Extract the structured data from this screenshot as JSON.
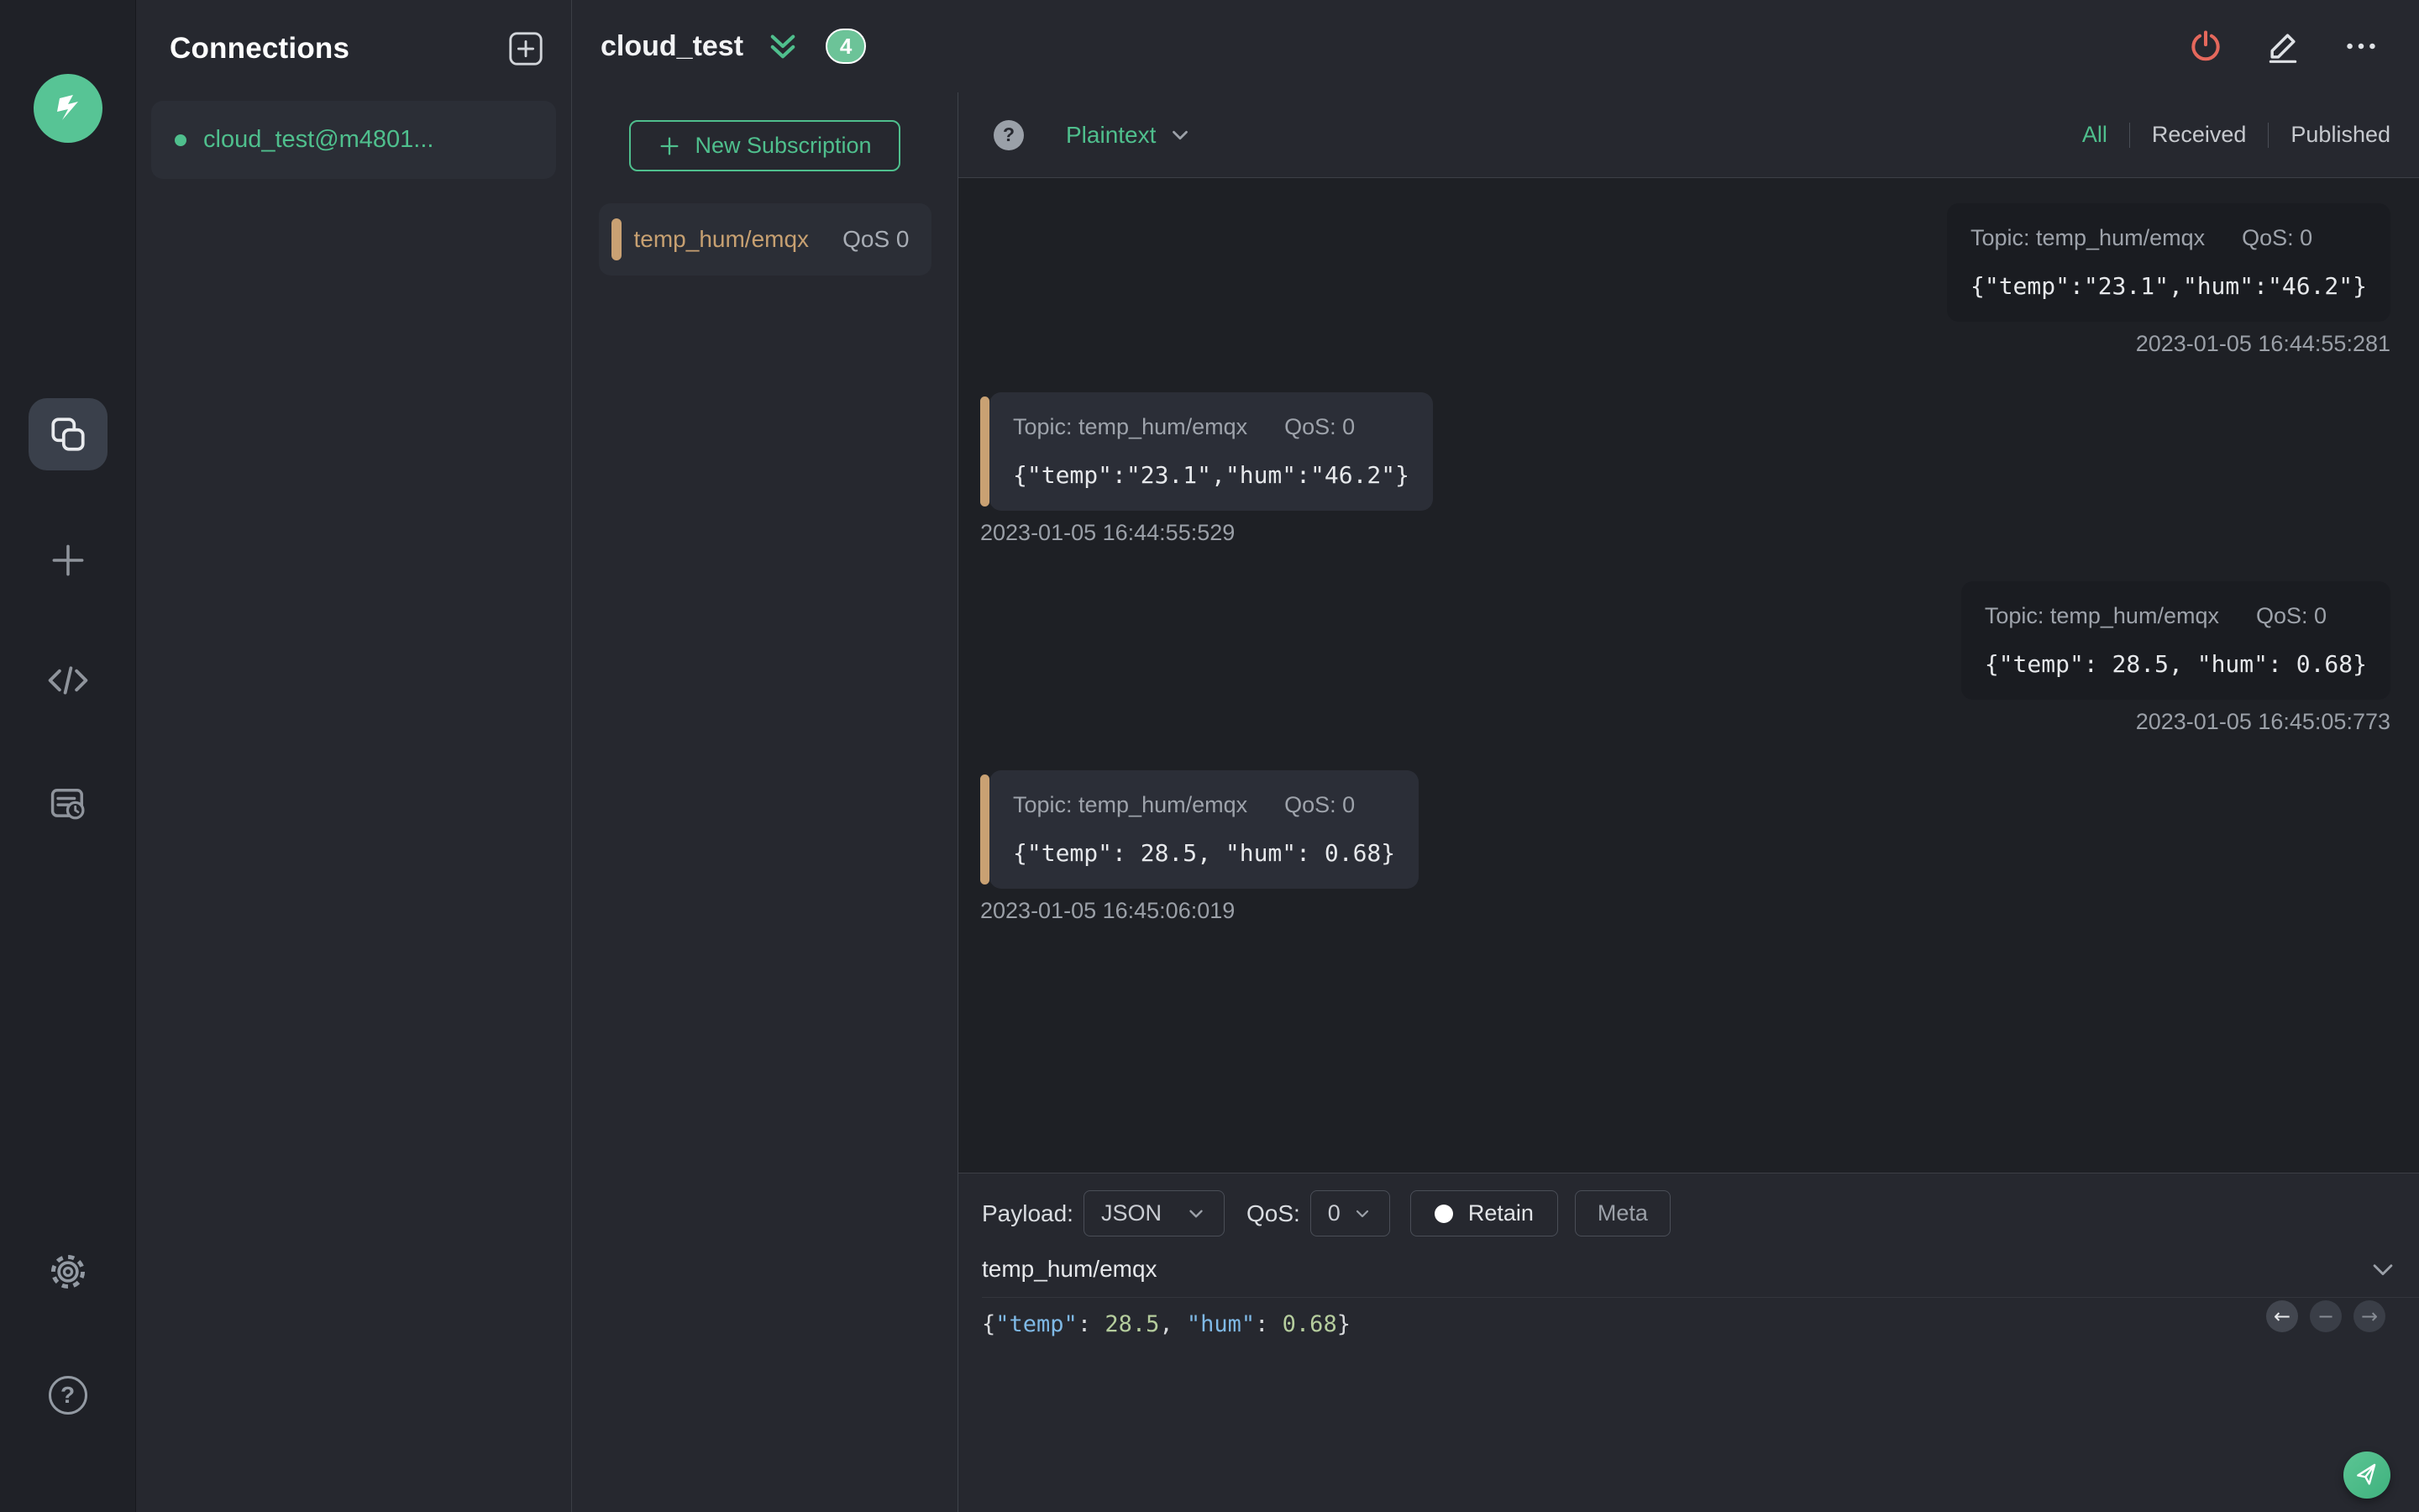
{
  "colors": {
    "accent_green": "#4fbf8d",
    "badge_green": "#6cc398",
    "subscription_accent": "#c9a173",
    "disconnect_red": "#e5685c",
    "editor_key_color": "#7fb9e6",
    "editor_number_color": "#b5cd9d"
  },
  "rail": {
    "icons": [
      "mqttx-logo",
      "connections",
      "new-connection",
      "script",
      "log",
      "settings",
      "help"
    ]
  },
  "connections_panel": {
    "title": "Connections",
    "items": [
      {
        "name": "cloud_test@m4801...",
        "status": "connected"
      }
    ]
  },
  "topbar": {
    "title": "cloud_test",
    "badge_count": "4"
  },
  "subscriptions_panel": {
    "new_subscription_label": "New Subscription",
    "items": [
      {
        "topic": "temp_hum/emqx",
        "qos_label": "QoS 0"
      }
    ]
  },
  "filter_bar": {
    "format_selected": "Plaintext",
    "tabs": [
      {
        "label": "All",
        "active": true
      },
      {
        "label": "Received",
        "active": false
      },
      {
        "label": "Published",
        "active": false
      }
    ]
  },
  "messages": [
    {
      "direction": "published",
      "meta_topic": "Topic: temp_hum/emqx",
      "meta_qos": "QoS: 0",
      "payload": "{\"temp\":\"23.1\",\"hum\":\"46.2\"}",
      "timestamp": "2023-01-05 16:44:55:281"
    },
    {
      "direction": "received",
      "meta_topic": "Topic: temp_hum/emqx",
      "meta_qos": "QoS: 0",
      "payload": "{\"temp\":\"23.1\",\"hum\":\"46.2\"}",
      "timestamp": "2023-01-05 16:44:55:529"
    },
    {
      "direction": "published",
      "meta_topic": "Topic: temp_hum/emqx",
      "meta_qos": "QoS: 0",
      "payload": "{\"temp\": 28.5, \"hum\": 0.68}",
      "timestamp": "2023-01-05 16:45:05:773"
    },
    {
      "direction": "received",
      "meta_topic": "Topic: temp_hum/emqx",
      "meta_qos": "QoS: 0",
      "payload": "{\"temp\": 28.5, \"hum\": 0.68}",
      "timestamp": "2023-01-05 16:45:06:019"
    }
  ],
  "publish": {
    "payload_label": "Payload:",
    "format_value": "JSON",
    "qos_label": "QoS:",
    "qos_value": "0",
    "retain_label": "Retain",
    "meta_label": "Meta",
    "topic": "temp_hum/emqx",
    "payload_tokens": [
      {
        "text": "{",
        "type": "punct"
      },
      {
        "text": "\"temp\"",
        "type": "key"
      },
      {
        "text": ": ",
        "type": "punct"
      },
      {
        "text": "28.5",
        "type": "number"
      },
      {
        "text": ", ",
        "type": "punct"
      },
      {
        "text": "\"hum\"",
        "type": "key"
      },
      {
        "text": ": ",
        "type": "punct"
      },
      {
        "text": "0.68",
        "type": "number"
      },
      {
        "text": "}",
        "type": "punct"
      }
    ],
    "nav_icons": [
      "previous-message",
      "collapse-count",
      "next-message"
    ]
  }
}
